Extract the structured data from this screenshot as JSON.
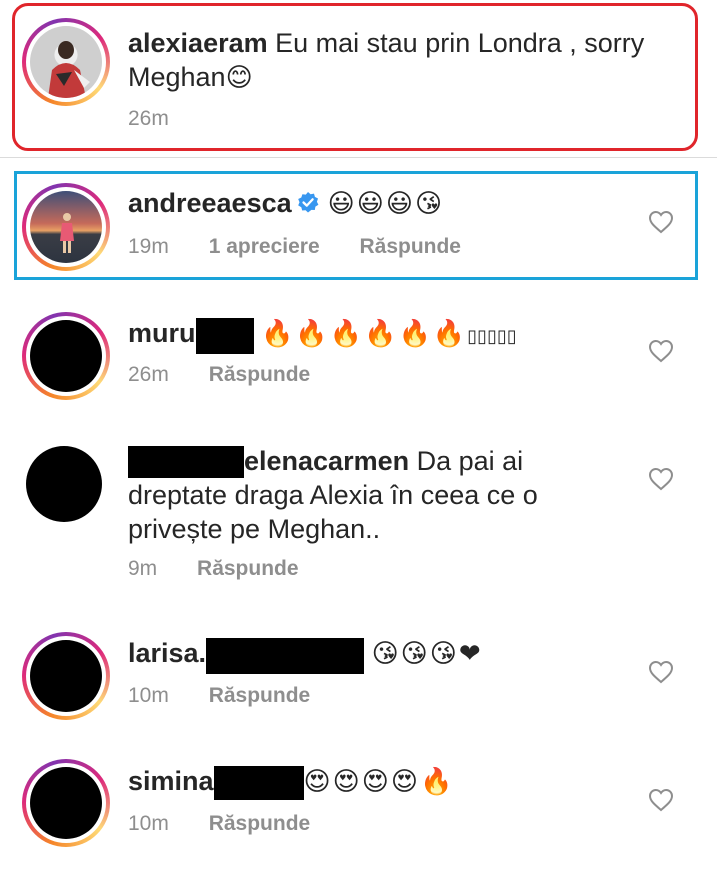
{
  "comments": [
    {
      "username": "alexiaeram",
      "text": " Eu mai stau prin Londra , sorry Meghan",
      "emoji": "😊",
      "time": "26m"
    },
    {
      "username": "andreeaesca",
      "emoji": "😃😃😃😘",
      "time": "19m",
      "likes": "1 apreciere",
      "reply": "Răspunde"
    },
    {
      "username": "muru",
      "emoji": "🔥🔥🔥🔥🔥🔥",
      "extra": "▯▯▯▯▯",
      "time": "26m",
      "reply": "Răspunde"
    },
    {
      "username": "elenacarmen",
      "text": " Da pai ai dreptate draga Alexia în ceea ce o privește pe Meghan..",
      "time": "9m",
      "reply": "Răspunde"
    },
    {
      "username": "larisa.",
      "emoji": "😘😘😘❤",
      "time": "10m",
      "reply": "Răspunde"
    },
    {
      "username": "simina",
      "emoji": "😍😍😍😍🔥",
      "time": "10m",
      "reply": "Răspunde"
    }
  ],
  "colors": {
    "highlight_red": "#e0252b",
    "highlight_blue": "#1aa3d9",
    "verified_blue": "#3897f0"
  },
  "icons": [
    "heart-icon",
    "verified-badge-icon"
  ]
}
